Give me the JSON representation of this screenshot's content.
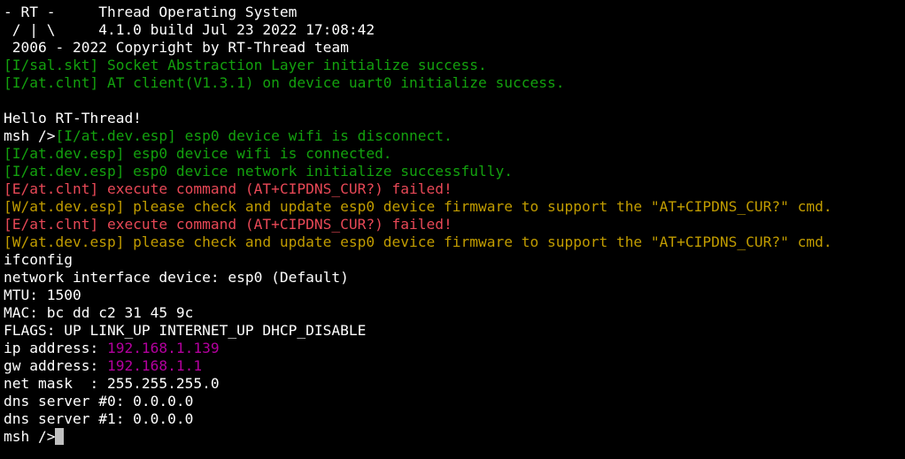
{
  "colors": {
    "background": "#000000",
    "default": "#ffffff",
    "info": "#13a10e",
    "error": "#e74856",
    "warning": "#c19c00",
    "highlight": "#b4009e",
    "cursor": "#c0c0c0"
  },
  "lines": [
    {
      "segments": [
        {
          "text": "- RT -     Thread Operating System",
          "color": "default"
        }
      ]
    },
    {
      "segments": [
        {
          "text": " / | \\     4.1.0 build Jul 23 2022 17:08:42",
          "color": "default"
        }
      ]
    },
    {
      "segments": [
        {
          "text": " 2006 - 2022 Copyright by RT-Thread team",
          "color": "default"
        }
      ]
    },
    {
      "segments": [
        {
          "text": "[I/sal.skt] Socket Abstraction Layer initialize success.",
          "color": "info"
        }
      ]
    },
    {
      "segments": [
        {
          "text": "[I/at.clnt] AT client(V1.3.1) on device uart0 initialize success.",
          "color": "info"
        }
      ]
    },
    {
      "segments": [
        {
          "text": "",
          "color": "default"
        }
      ]
    },
    {
      "segments": [
        {
          "text": "Hello RT-Thread!",
          "color": "default"
        }
      ]
    },
    {
      "segments": [
        {
          "text": "msh />",
          "color": "default"
        },
        {
          "text": "[I/at.dev.esp] esp0 device wifi is disconnect.",
          "color": "info"
        }
      ]
    },
    {
      "segments": [
        {
          "text": "[I/at.dev.esp] esp0 device wifi is connected.",
          "color": "info"
        }
      ]
    },
    {
      "segments": [
        {
          "text": "[I/at.dev.esp] esp0 device network initialize successfully.",
          "color": "info"
        }
      ]
    },
    {
      "segments": [
        {
          "text": "[E/at.clnt] execute command (AT+CIPDNS_CUR?) failed!",
          "color": "error"
        }
      ]
    },
    {
      "segments": [
        {
          "text": "[W/at.dev.esp] please check and update esp0 device firmware to support the \"AT+CIPDNS_CUR?\" cmd.",
          "color": "warning"
        }
      ]
    },
    {
      "segments": [
        {
          "text": "[E/at.clnt] execute command (AT+CIPDNS_CUR?) failed!",
          "color": "error"
        }
      ]
    },
    {
      "segments": [
        {
          "text": "[W/at.dev.esp] please check and update esp0 device firmware to support the \"AT+CIPDNS_CUR?\" cmd.",
          "color": "warning"
        }
      ]
    },
    {
      "segments": [
        {
          "text": "ifconfig",
          "color": "default"
        }
      ]
    },
    {
      "segments": [
        {
          "text": "network interface device: esp0 (Default)",
          "color": "default"
        }
      ]
    },
    {
      "segments": [
        {
          "text": "MTU: 1500",
          "color": "default"
        }
      ]
    },
    {
      "segments": [
        {
          "text": "MAC: bc dd c2 31 45 9c",
          "color": "default"
        }
      ]
    },
    {
      "segments": [
        {
          "text": "FLAGS: UP LINK_UP INTERNET_UP DHCP_DISABLE",
          "color": "default"
        }
      ]
    },
    {
      "segments": [
        {
          "text": "ip address: ",
          "color": "default"
        },
        {
          "text": "192.168.1.139",
          "color": "highlight"
        }
      ]
    },
    {
      "segments": [
        {
          "text": "gw address: ",
          "color": "default"
        },
        {
          "text": "192.168.1.1",
          "color": "highlight"
        }
      ]
    },
    {
      "segments": [
        {
          "text": "net mask  : 255.255.255.0",
          "color": "default"
        }
      ]
    },
    {
      "segments": [
        {
          "text": "dns server #0: 0.0.0.0",
          "color": "default"
        }
      ]
    },
    {
      "segments": [
        {
          "text": "dns server #1: 0.0.0.0",
          "color": "default"
        }
      ]
    }
  ],
  "prompt": {
    "text": "msh />",
    "input_value": ""
  }
}
